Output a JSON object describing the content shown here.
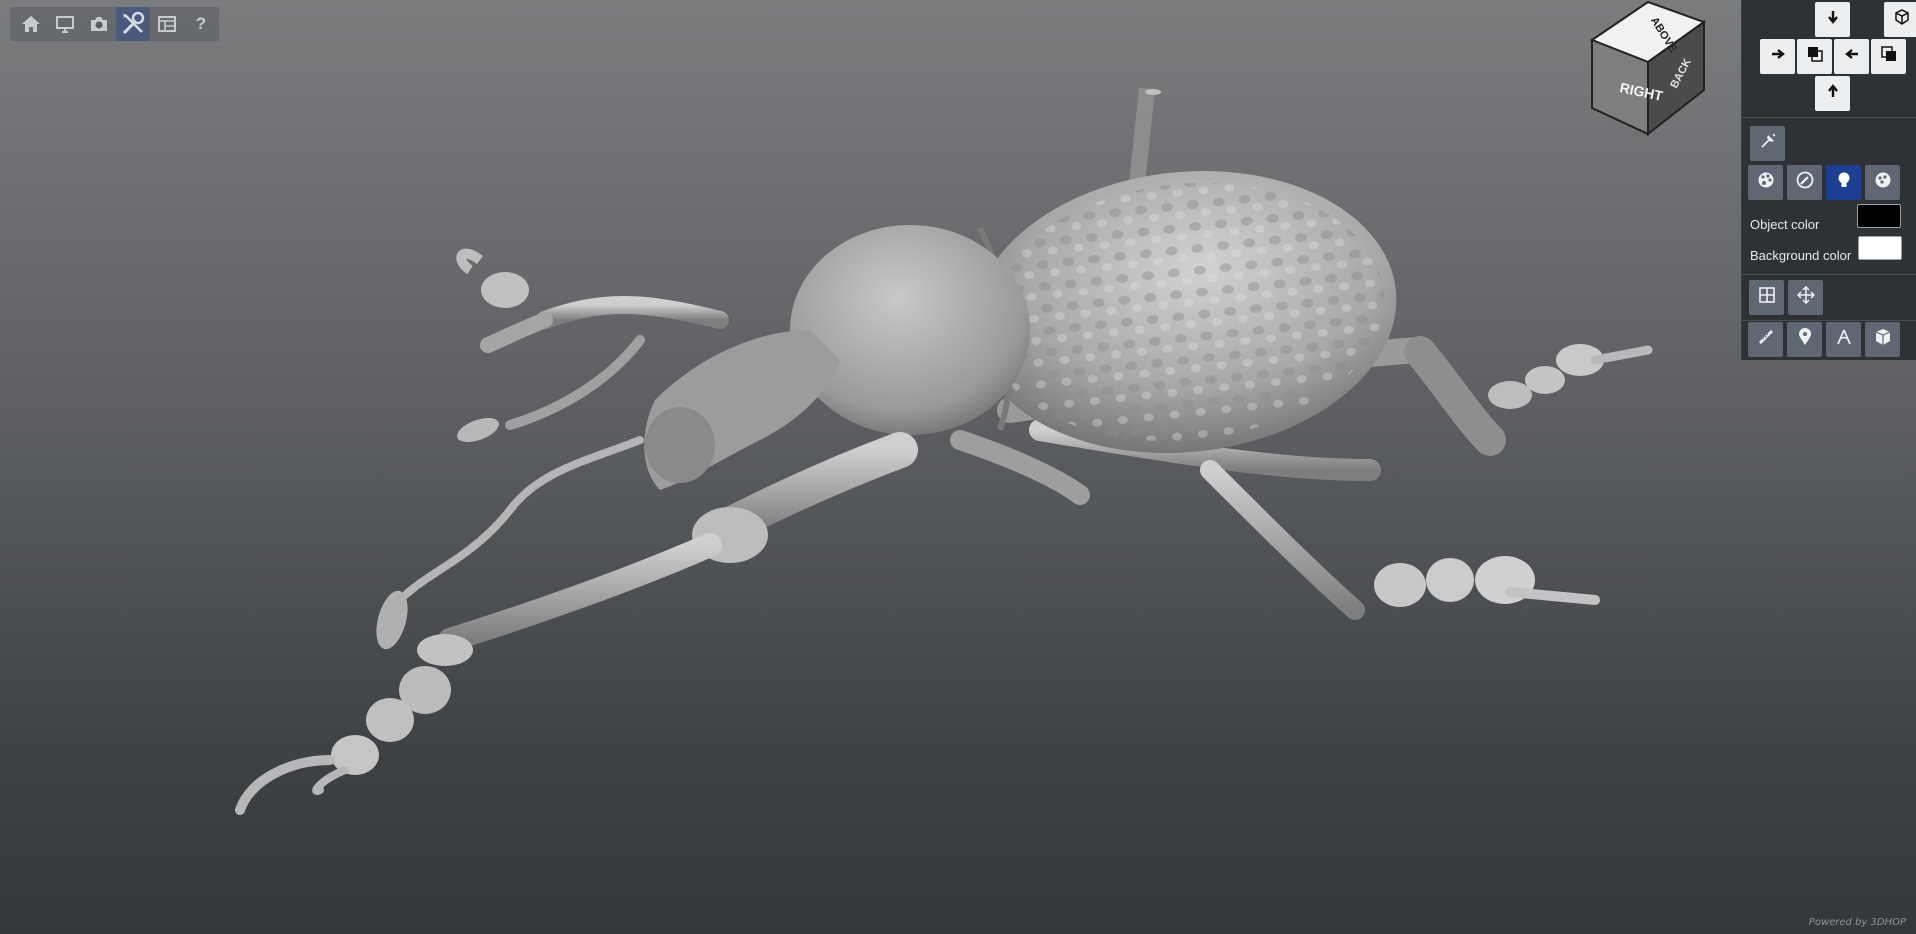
{
  "toolbar": {
    "items": [
      {
        "name": "home",
        "icon": "home-icon"
      },
      {
        "name": "presentation",
        "icon": "monitor-icon"
      },
      {
        "name": "screenshot",
        "icon": "camera-icon"
      },
      {
        "name": "tools",
        "icon": "wrench-screwdriver-icon",
        "active": true
      },
      {
        "name": "layout",
        "icon": "window-layout-icon"
      },
      {
        "name": "help",
        "icon": "help-icon",
        "label": "?"
      }
    ]
  },
  "view_cube": {
    "front": "RIGHT",
    "top": "ABOVE",
    "side": "BACK"
  },
  "panel": {
    "orientation_buttons": [
      "arrow-down-icon",
      "arrow-right-icon",
      "front-view-icon",
      "arrow-left-icon",
      "back-view-icon",
      "arrow-up-icon",
      "cube-icon"
    ],
    "object_color_label": "Object color",
    "object_color": "#000000",
    "background_color_label": "Background color",
    "background_color": "#ffffff",
    "accent_color": "#1c3f93"
  },
  "footer": {
    "powered_by": "Powered by 3DHOP"
  }
}
